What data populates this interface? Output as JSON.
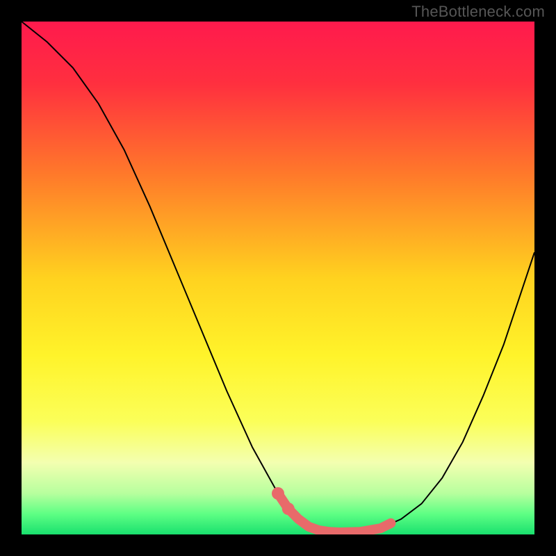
{
  "watermark": "TheBottleneck.com",
  "chart_data": {
    "type": "line",
    "title": "",
    "xlabel": "",
    "ylabel": "",
    "xlim": [
      0,
      100
    ],
    "ylim": [
      0,
      100
    ],
    "gradient_stops": [
      {
        "offset": 0.0,
        "color": "#ff1a4d"
      },
      {
        "offset": 0.12,
        "color": "#ff2f3f"
      },
      {
        "offset": 0.3,
        "color": "#ff7a2a"
      },
      {
        "offset": 0.5,
        "color": "#ffd21f"
      },
      {
        "offset": 0.65,
        "color": "#fff32a"
      },
      {
        "offset": 0.78,
        "color": "#fbff59"
      },
      {
        "offset": 0.86,
        "color": "#f3ffb0"
      },
      {
        "offset": 0.92,
        "color": "#b7ff9e"
      },
      {
        "offset": 0.96,
        "color": "#5eff84"
      },
      {
        "offset": 1.0,
        "color": "#19e06e"
      }
    ],
    "series": [
      {
        "name": "bottleneck-curve",
        "stroke": "#000000",
        "x": [
          0,
          5,
          10,
          15,
          20,
          25,
          30,
          35,
          40,
          45,
          50,
          52,
          54,
          56,
          58,
          60,
          62,
          66,
          70,
          74,
          78,
          82,
          86,
          90,
          94,
          100
        ],
        "values": [
          100,
          96,
          91,
          84,
          75,
          64,
          52,
          40,
          28,
          17,
          8,
          5,
          3,
          1.5,
          0.8,
          0.5,
          0.4,
          0.5,
          1.2,
          3,
          6,
          11,
          18,
          27,
          37,
          55
        ]
      }
    ],
    "highlight": {
      "name": "selected-range",
      "stroke": "#e86a6a",
      "x": [
        50,
        52,
        54,
        56,
        58,
        60,
        62,
        66,
        70,
        72
      ],
      "values": [
        8,
        5,
        3,
        1.5,
        0.8,
        0.5,
        0.4,
        0.5,
        1.2,
        2.2
      ]
    },
    "highlight_dots": {
      "name": "selected-points",
      "fill": "#e86a6a",
      "points": [
        {
          "x": 50,
          "y": 8
        },
        {
          "x": 52,
          "y": 5
        }
      ]
    }
  }
}
